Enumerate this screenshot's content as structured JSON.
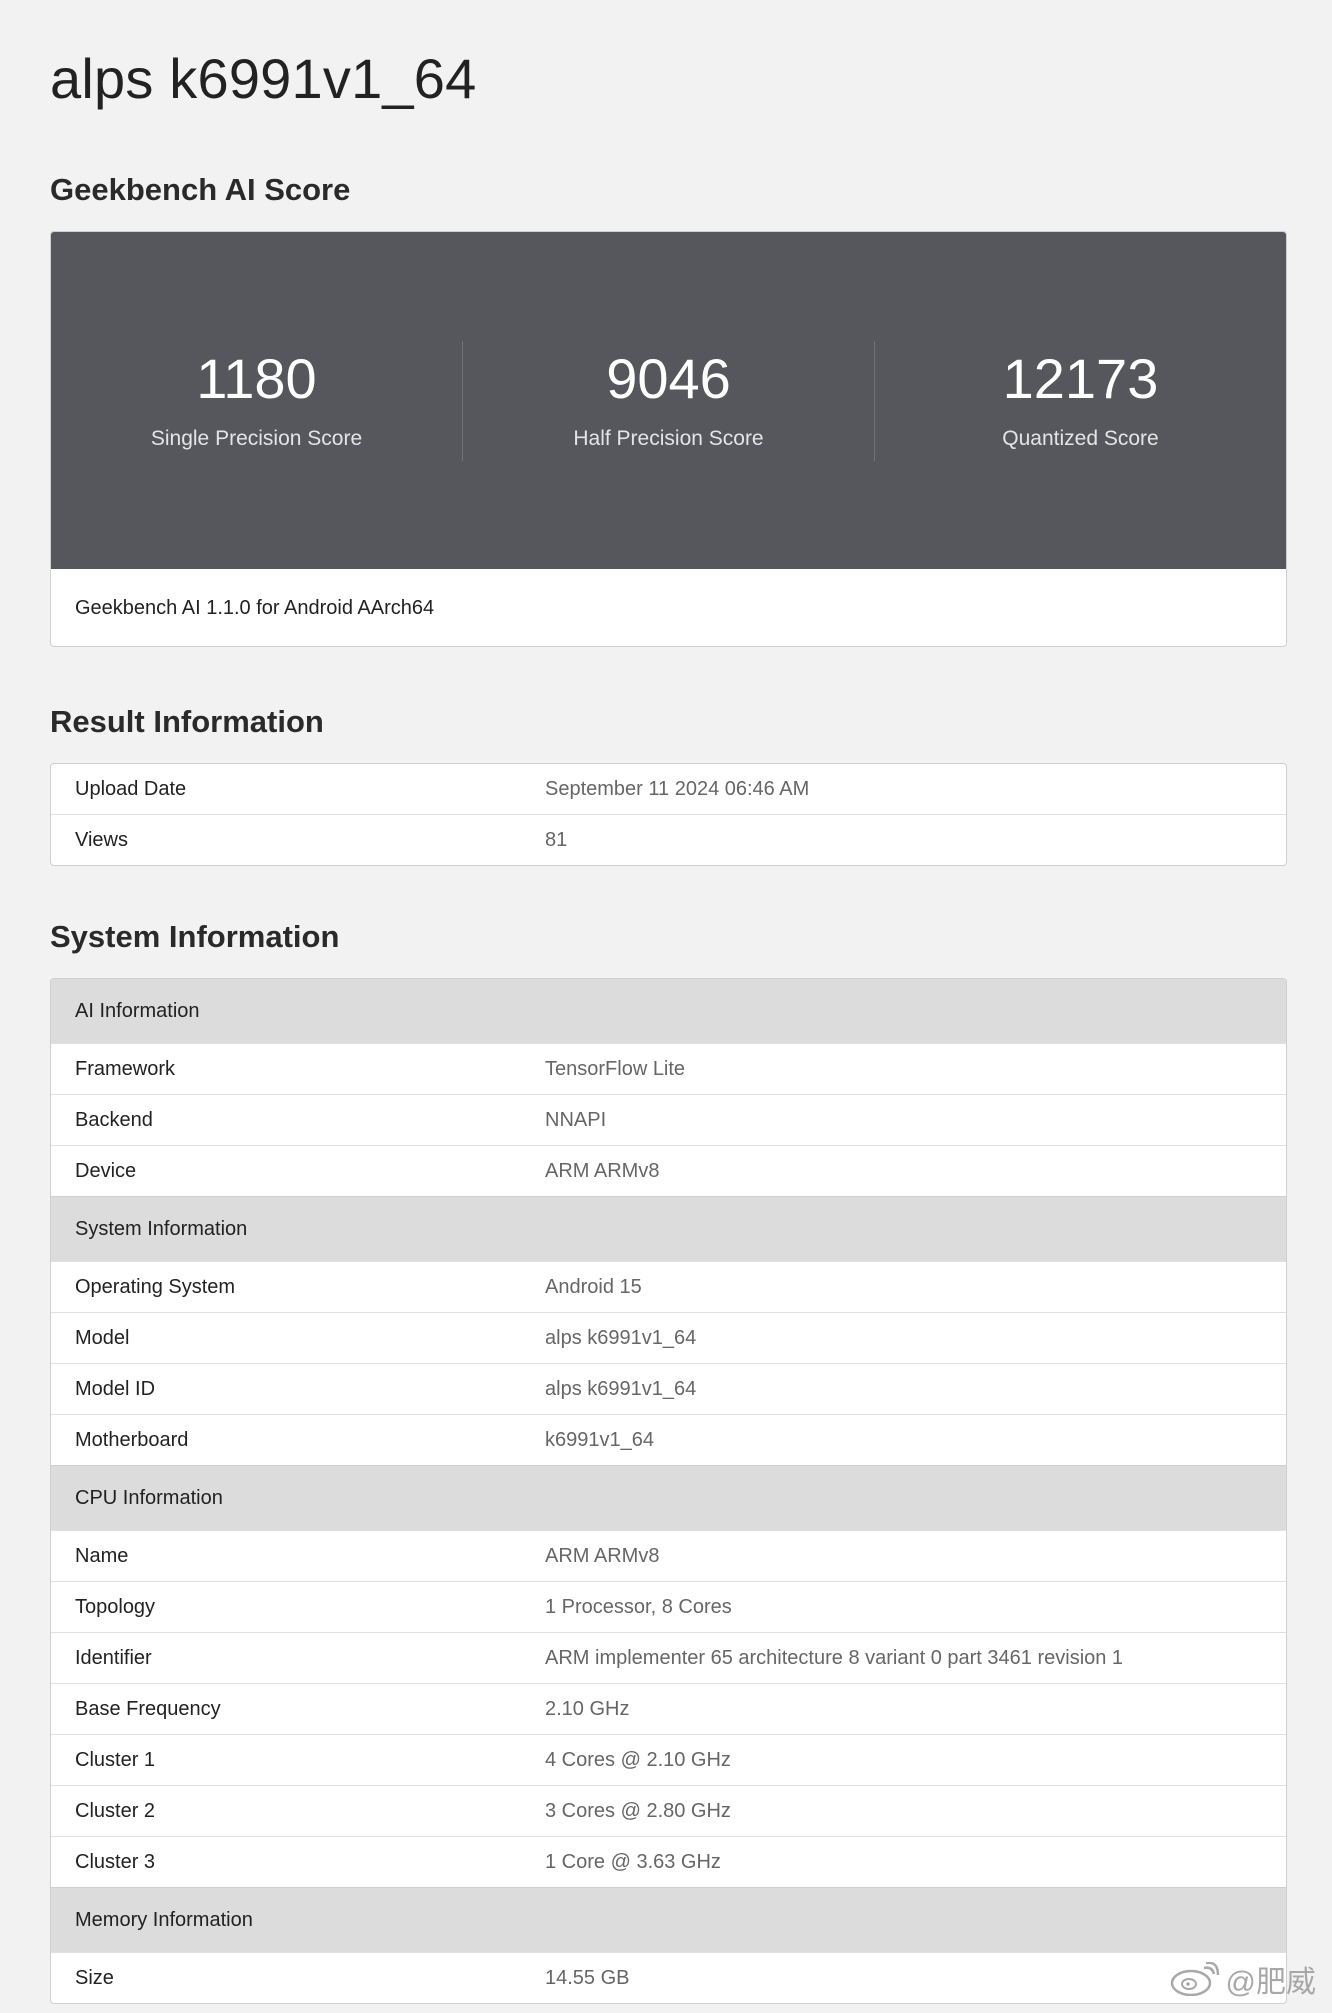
{
  "header": {
    "title": "alps k6991v1_64"
  },
  "score_section": {
    "heading": "Geekbench AI Score",
    "scores": [
      {
        "value": "1180",
        "label": "Single Precision Score"
      },
      {
        "value": "9046",
        "label": "Half Precision Score"
      },
      {
        "value": "12173",
        "label": "Quantized Score"
      }
    ],
    "footer": "Geekbench AI 1.1.0 for Android AArch64"
  },
  "result_section": {
    "heading": "Result Information",
    "rows": [
      {
        "key": "Upload Date",
        "value": "September 11 2024 06:46 AM"
      },
      {
        "key": "Views",
        "value": "81"
      }
    ]
  },
  "system_section": {
    "heading": "System Information",
    "groups": [
      {
        "title": "AI Information",
        "rows": [
          {
            "key": "Framework",
            "value": "TensorFlow Lite"
          },
          {
            "key": "Backend",
            "value": "NNAPI"
          },
          {
            "key": "Device",
            "value": "ARM ARMv8"
          }
        ]
      },
      {
        "title": "System Information",
        "rows": [
          {
            "key": "Operating System",
            "value": "Android 15"
          },
          {
            "key": "Model",
            "value": "alps k6991v1_64"
          },
          {
            "key": "Model ID",
            "value": "alps k6991v1_64"
          },
          {
            "key": "Motherboard",
            "value": "k6991v1_64"
          }
        ]
      },
      {
        "title": "CPU Information",
        "rows": [
          {
            "key": "Name",
            "value": "ARM ARMv8"
          },
          {
            "key": "Topology",
            "value": "1 Processor, 8 Cores"
          },
          {
            "key": "Identifier",
            "value": "ARM implementer 65 architecture 8 variant 0 part 3461 revision 1"
          },
          {
            "key": "Base Frequency",
            "value": "2.10 GHz"
          },
          {
            "key": "Cluster 1",
            "value": "4 Cores @ 2.10 GHz"
          },
          {
            "key": "Cluster 2",
            "value": "3 Cores @ 2.80 GHz"
          },
          {
            "key": "Cluster 3",
            "value": "1 Core @ 3.63 GHz"
          }
        ]
      },
      {
        "title": "Memory Information",
        "rows": [
          {
            "key": "Size",
            "value": "14.55 GB"
          }
        ]
      }
    ]
  },
  "watermark": {
    "icon": "weibo-icon",
    "text": "@肥威"
  }
}
